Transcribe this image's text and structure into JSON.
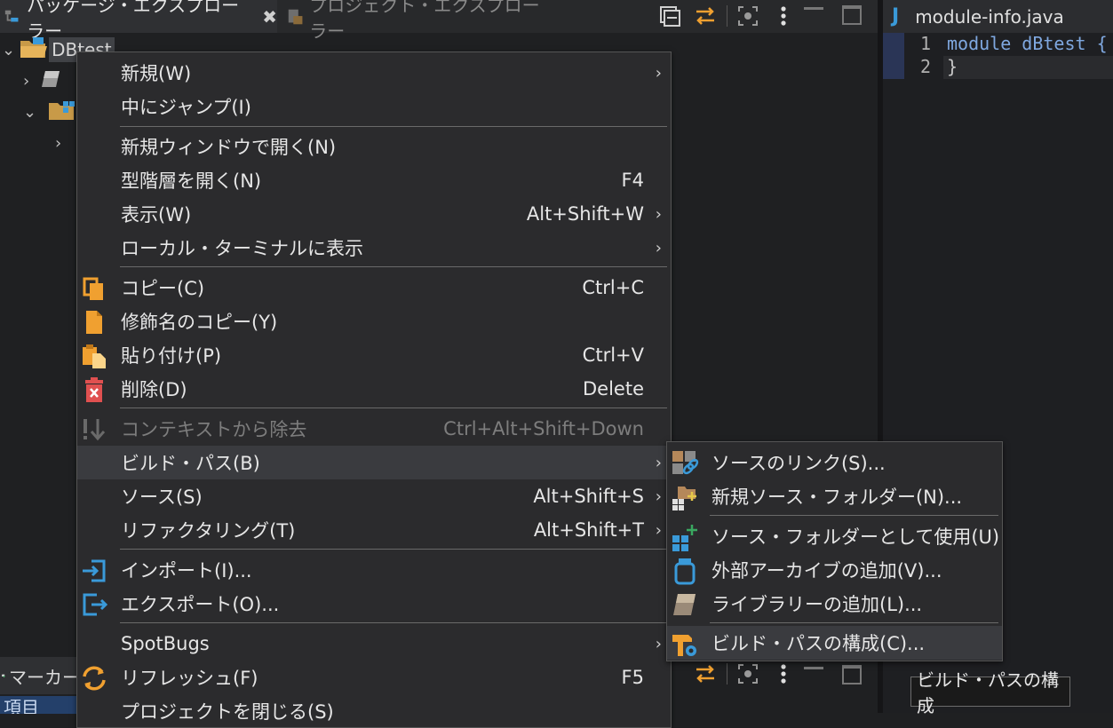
{
  "tabs": {
    "package_explorer": "パッケージ・エクスプローラー",
    "project_explorer": "プロジェクト・エクスプローラー"
  },
  "tree": {
    "project": "DBtest"
  },
  "editor": {
    "tab_title": "module-info.java",
    "lines": [
      {
        "num": "1",
        "code": "module dBtest {"
      },
      {
        "num": "2",
        "code": "}"
      }
    ]
  },
  "bottom_panel": {
    "markers_tab": "マーカー",
    "column_header": "項目"
  },
  "context_menu": {
    "new": {
      "label": "新規(W)"
    },
    "go_into": {
      "label": "中にジャンプ(I)"
    },
    "open_new_window": {
      "label": "新規ウィンドウで開く(N)"
    },
    "open_type_hierarchy": {
      "label": "型階層を開く(N)",
      "shortcut": "F4"
    },
    "show_in": {
      "label": "表示(W)",
      "shortcut": "Alt+Shift+W"
    },
    "show_in_terminal": {
      "label": "ローカル・ターミナルに表示"
    },
    "copy": {
      "label": "コピー(C)",
      "shortcut": "Ctrl+C"
    },
    "copy_qualified": {
      "label": "修飾名のコピー(Y)"
    },
    "paste": {
      "label": "貼り付け(P)",
      "shortcut": "Ctrl+V"
    },
    "delete": {
      "label": "削除(D)",
      "shortcut": "Delete"
    },
    "remove_context": {
      "label": "コンテキストから除去",
      "shortcut": "Ctrl+Alt+Shift+Down"
    },
    "build_path": {
      "label": "ビルド・パス(B)"
    },
    "source": {
      "label": "ソース(S)",
      "shortcut": "Alt+Shift+S"
    },
    "refactor": {
      "label": "リファクタリング(T)",
      "shortcut": "Alt+Shift+T"
    },
    "import": {
      "label": "インポート(I)..."
    },
    "export": {
      "label": "エクスポート(O)..."
    },
    "spotbugs": {
      "label": "SpotBugs"
    },
    "refresh": {
      "label": "リフレッシュ(F)",
      "shortcut": "F5"
    },
    "close_project": {
      "label": "プロジェクトを閉じる(S)"
    }
  },
  "build_path_submenu": {
    "link_source": "ソースのリンク(S)...",
    "new_source_folder": "新規ソース・フォルダー(N)...",
    "use_as_source": "ソース・フォルダーとして使用(U)",
    "add_external_archives": "外部アーカイブの追加(V)...",
    "add_libraries": "ライブラリーの追加(L)...",
    "configure_build_path": "ビルド・パスの構成(C)..."
  },
  "tooltip": "ビルド・パスの構成",
  "colors": {
    "menu_bg": "#2b2b2d",
    "highlight": "#3a3b3f",
    "accent_orange": "#f0a030",
    "accent_blue": "#3a9ad9",
    "delete_red": "#e05050"
  }
}
